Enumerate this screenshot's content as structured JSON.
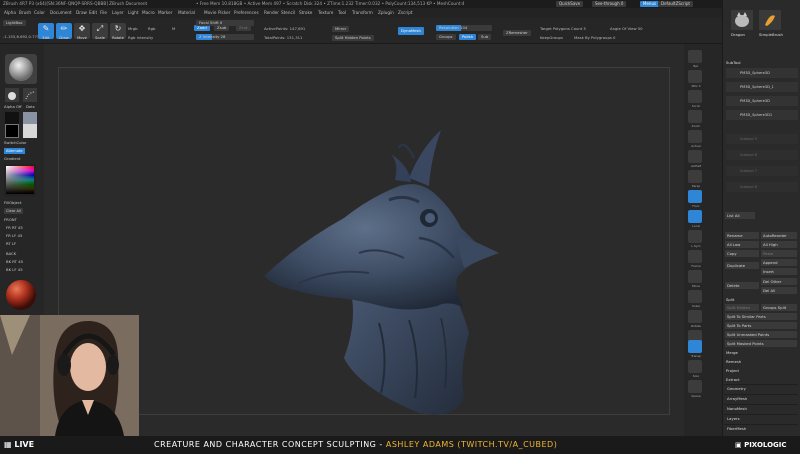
{
  "titlebar": {
    "left": "ZBrush 4R7 P3 (x64)[SN:36NF-QNQP-SRRS-QBBB]  ZBrush Document",
    "stats": "• Free Mem 10.818GB • Active Mem 497 • Scratch Disk 324 • ZTime:1.232 Timer:0.032 • PolyCount:134,513 KP • MeshCount:4",
    "quicksave": "QuickSave",
    "seethrough": "See-through 0",
    "menus": "Menus",
    "defaultscript": "DefaultZScript"
  },
  "menu": [
    "Alpha",
    "Brush",
    "Color",
    "Document",
    "Draw",
    "Edit",
    "File",
    "Layer",
    "Light",
    "Macro",
    "Marker",
    "Material",
    "Movie",
    "Picker",
    "Preferences",
    "Render",
    "Stencil",
    "Stroke",
    "Texture",
    "Tool",
    "Transform",
    "Zplugin",
    "Zscript"
  ],
  "shelf": {
    "lightbox": "LightBox",
    "coords": "-1.155,8.692,0.775",
    "tools": [
      {
        "label": "Edit",
        "glyph": "✎",
        "active": true
      },
      {
        "label": "Draw",
        "glyph": "✏",
        "active": true
      },
      {
        "label": "Move",
        "glyph": "✥",
        "active": false
      },
      {
        "label": "Scale",
        "glyph": "⤢",
        "active": false
      },
      {
        "label": "Rotate",
        "glyph": "↻",
        "active": false
      }
    ],
    "rgb": "Rgb",
    "rgb_intensity": "Rgb Intensity",
    "mrgb": "Mrgb",
    "m": "M",
    "zadd": "Zadd",
    "zsub": "Zsub",
    "zcut": "Zcut",
    "focal_shift": "Focal Shift 0",
    "draw_size": "Draw Size 64",
    "z_intensity": "Z Intensity 28",
    "active_points": "ActivePoints: 147,691",
    "total_points": "TotalPoints: 131,311",
    "mirror": "Mirror",
    "split_hidden": "Split Hidden Points",
    "dynamesh": "DynaMesh",
    "resolution": "Resolution 104",
    "resolution_value": 0.45,
    "groups": "Groups",
    "polish": "Polish",
    "sub": "Sub",
    "zremesher": "ZRemesher",
    "target_polygons": "Target Polygons Count 5",
    "keepgroups": "KeepGroups",
    "angle_of_view": "Angle Of View 50",
    "mask_by_polygroups": "Mask By Polygroups 0"
  },
  "lefttray": {
    "alpha_off": "Alpha Off",
    "dots": "Dots",
    "switch_color": "SwitchColor",
    "alternate": "Alternate",
    "gradient": "Gradient",
    "fill_object": "FillObject",
    "clear_all": "Clear All",
    "front": "FRONT",
    "views": [
      "FR  RT  45",
      "FR  LF  45",
      "RT    LF",
      "BACK",
      "BK  RT  45",
      "BK  LF  45"
    ]
  },
  "rightcol": {
    "labels": [
      "Bpr",
      "SPix 3",
      "Scroll",
      "Zoom",
      "Actual",
      "AAHalf",
      "Persp",
      "Floor",
      "Local",
      "L.Sym",
      "Frame",
      "Move",
      "Scale",
      "Rotate",
      "Line Fill",
      "Transp",
      "Solo",
      "Xpose"
    ]
  },
  "rpanel": {
    "subtool_title": "SubTool",
    "subtools": [
      {
        "name": "PM3D_Sphere3D",
        "dim": false
      },
      {
        "name": "PM3D_Sphere3D_1",
        "dim": false
      },
      {
        "name": "PM3D_Sphere3D",
        "dim": false
      },
      {
        "name": "PM3D_Sphere3D1",
        "dim": false
      },
      {
        "name": "Subtool 5",
        "dim": true
      },
      {
        "name": "Subtool 6",
        "dim": true
      },
      {
        "name": "Subtool 7",
        "dim": true
      },
      {
        "name": "Subtool 8",
        "dim": true
      }
    ],
    "list_all": "List All",
    "rename": "Rename",
    "autoreorder": "AutoReorder",
    "all_low": "All Low",
    "all_high": "All High",
    "copy": "Copy",
    "paste": "Paste",
    "duplicate": "Duplicate",
    "append": "Append",
    "insert": "Insert",
    "delete": "Delete",
    "del_other": "Del Other",
    "del_all": "Del All",
    "split": "Split",
    "split_hidden": "Split Hidden",
    "groups_split": "Groups Split",
    "split_similar": "Split To Similar Parts",
    "split_parts": "Split To Parts",
    "split_unmasked": "Split Unmasked Points",
    "split_masked": "Split Masked Points",
    "merge": "Merge",
    "remesh": "Remesh",
    "project": "Project",
    "extract": "Extract",
    "geometry": "Geometry",
    "arraymesh": "ArrayMesh",
    "nanomesh": "NanoMesh",
    "layers": "Layers",
    "fibermesh": "FiberMesh",
    "brush_names": [
      "Dragon",
      "SimpleBrush"
    ]
  },
  "banner": {
    "live": "LIVE",
    "title_main": "CREATURE AND CHARACTER CONCEPT SCULPTING - ",
    "title_accent": "ASHLEY ADAMS (TWITCH.TV/A_CUBED)",
    "brand": "PIXOLOGIC"
  },
  "colors": {
    "accent": "#2f86d6",
    "banner_accent": "#f2b632",
    "sculpt": "#3d4c63"
  }
}
